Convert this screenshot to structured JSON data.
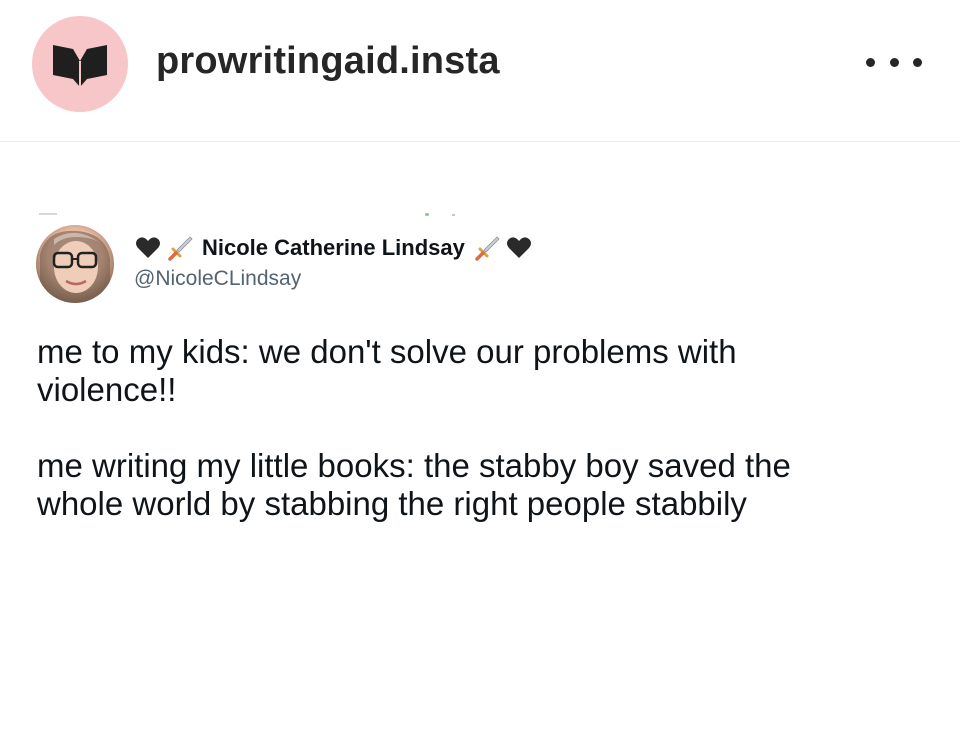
{
  "post": {
    "account": {
      "username": "prowritingaid.insta",
      "avatar_color": "#f6c6c8",
      "logo_icon": "open-book-heart-icon"
    },
    "more_icon": "more-horizontal-icon"
  },
  "tweet": {
    "display_name": "Nicole Catherine Lindsay",
    "handle": "@NicoleCLindsay",
    "name_decorations": {
      "left": [
        "black-heart-icon",
        "dagger-icon"
      ],
      "right": [
        "dagger-icon",
        "black-heart-icon"
      ]
    },
    "text": "me to my kids: we don't solve our problems with\nviolence!!\n\nme writing my little books: the stabby boy saved the\nwhole world by stabbing the right people stabbily"
  },
  "colors": {
    "text_primary": "#0f1419",
    "text_secondary": "#536471",
    "ig_text": "#262626"
  }
}
